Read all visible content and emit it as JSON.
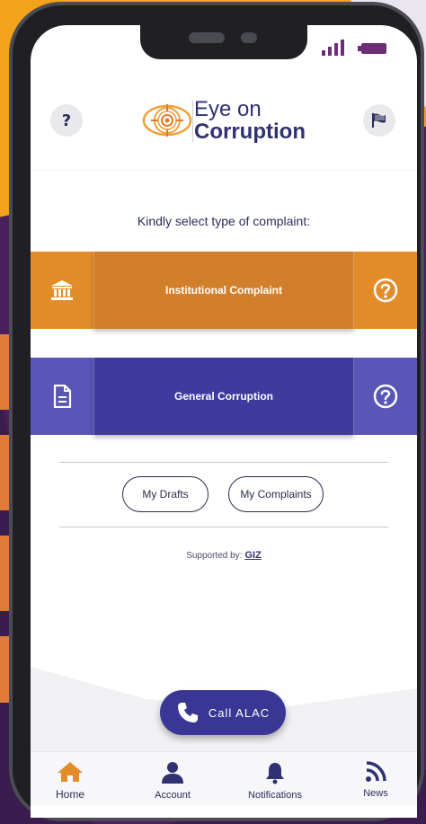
{
  "header": {
    "logo_line1": "Eye on",
    "logo_line2": "Corruption",
    "help_label": "?"
  },
  "main": {
    "prompt": "Kindly select type of complaint:",
    "complaints": [
      {
        "label": "Institutional Complaint",
        "icon": "bank-icon"
      },
      {
        "label": "General Corruption",
        "icon": "document-icon"
      }
    ],
    "my_drafts_label": "My Drafts",
    "my_complaints_label": "My Complaints",
    "supported_label": "Supported by:",
    "supported_org": "GIZ",
    "call_label": "Call ALAC"
  },
  "nav": {
    "items": [
      {
        "label": "Home",
        "icon": "home-icon"
      },
      {
        "label": "Account",
        "icon": "user-icon"
      },
      {
        "label": "Notifications",
        "icon": "bell-icon"
      },
      {
        "label": "News",
        "icon": "rss-icon"
      }
    ]
  },
  "colors": {
    "brand_navy": "#2f3173",
    "orange": "#d27f2b",
    "purple": "#3f3a9e",
    "accent_orange": "#e38d2a"
  }
}
